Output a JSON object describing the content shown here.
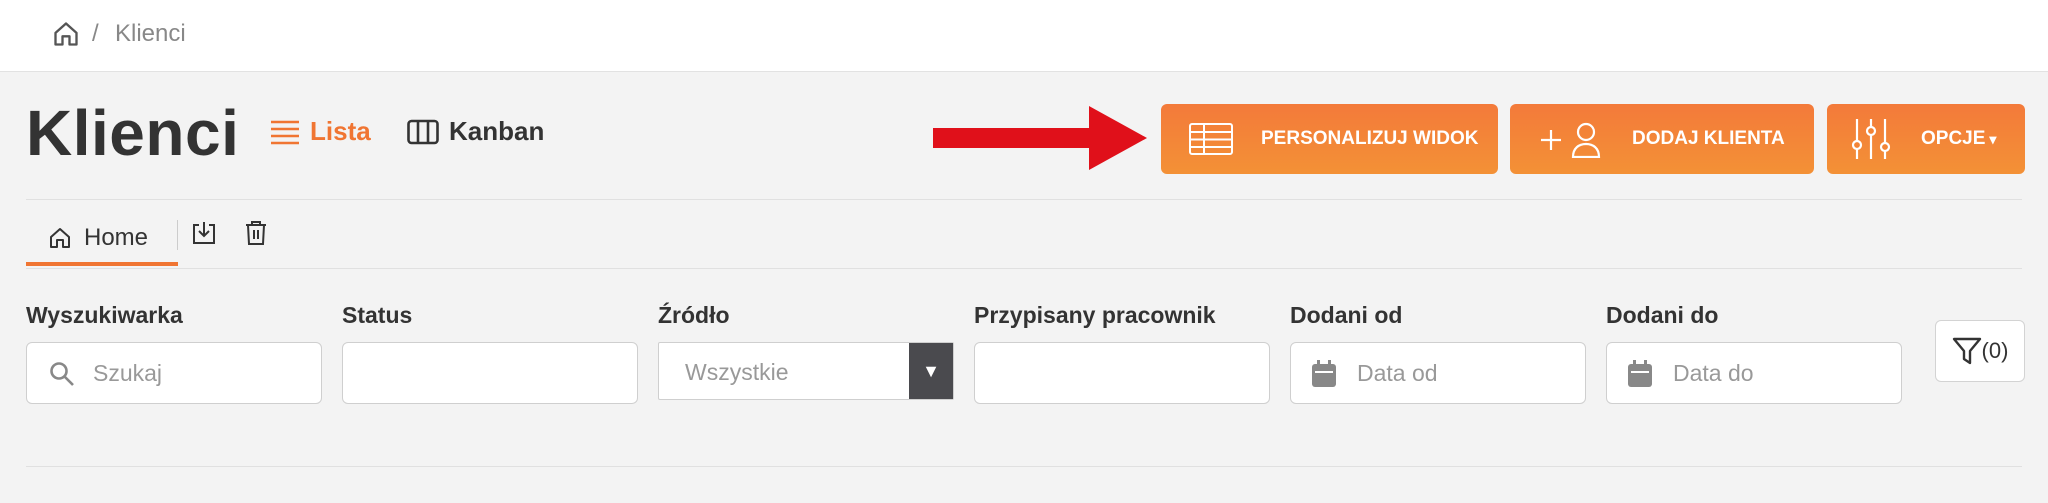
{
  "breadcrumb": {
    "separator": "/",
    "current": "Klienci"
  },
  "page": {
    "title": "Klienci"
  },
  "views": {
    "list_label": "Lista",
    "kanban_label": "Kanban",
    "active": "Lista"
  },
  "actions": {
    "personalize_label": "PERSONALIZUJ WIDOK",
    "add_client_label": "DODAJ KLIENTA",
    "options_label": "OPCJE",
    "options_caret": "▾"
  },
  "tabs": {
    "home_label": "Home"
  },
  "filters": {
    "search": {
      "label": "Wyszukiwarka",
      "placeholder": "Szukaj",
      "value": ""
    },
    "status": {
      "label": "Status",
      "value": ""
    },
    "source": {
      "label": "Źródło",
      "value": "Wszystkie",
      "arrow": "▼"
    },
    "assignee": {
      "label": "Przypisany pracownik",
      "value": ""
    },
    "added_from": {
      "label": "Dodani od",
      "placeholder": "Data od",
      "value": ""
    },
    "added_to": {
      "label": "Dodani do",
      "placeholder": "Data do",
      "value": ""
    },
    "filter_count": "(0)"
  },
  "colors": {
    "accent": "#f07532",
    "annotation_arrow": "#e0101a",
    "dark": "#333333"
  },
  "icons": [
    "home-icon",
    "list-icon",
    "kanban-icon",
    "table-icon",
    "add-user-icon",
    "sliders-icon",
    "download-icon",
    "trash-icon",
    "search-icon",
    "calendar-icon",
    "filter-icon"
  ]
}
